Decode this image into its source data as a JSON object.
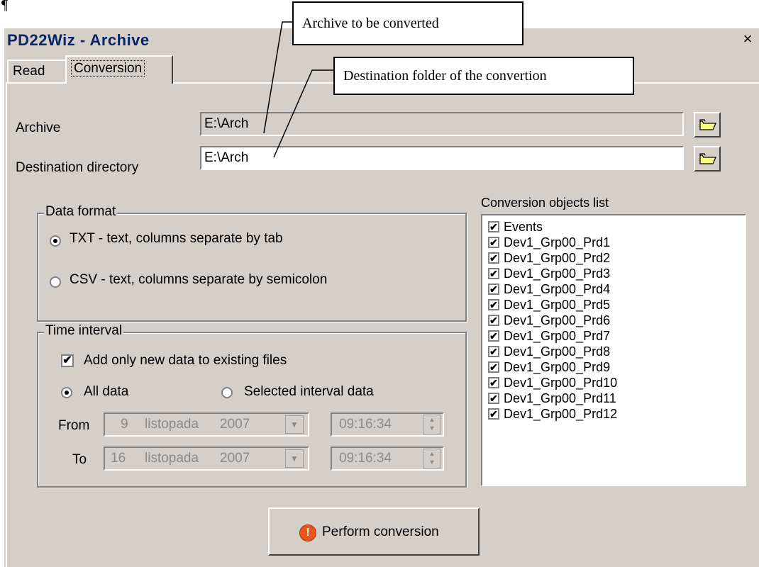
{
  "marker": "¶",
  "window": {
    "title": "PD22Wiz - Archive",
    "close_glyph": "×"
  },
  "tabs": [
    {
      "label": "Read"
    },
    {
      "label": "Conversion"
    }
  ],
  "archive": {
    "label": "Archive",
    "value": "E:\\Arch"
  },
  "destination": {
    "label": "Destination directory",
    "value": "E:\\Arch"
  },
  "data_format": {
    "legend": "Data format",
    "options": [
      {
        "label": "TXT - text, columns separate by tab",
        "selected": true
      },
      {
        "label": "CSV - text, columns separate by semicolon",
        "selected": false
      }
    ]
  },
  "time_interval": {
    "legend": "Time interval",
    "add_new_label": "Add only new data to existing files",
    "add_new_checked": true,
    "all_data_label": "All data",
    "selected_interval_label": "Selected interval data",
    "from_label": "From",
    "to_label": "To",
    "from": {
      "day": "9",
      "month": "listopada",
      "year": "2007",
      "time": "09:16:34"
    },
    "to": {
      "day": "16",
      "month": "listopada",
      "year": "2007",
      "time": "09:16:34"
    }
  },
  "objects": {
    "label": "Conversion objects list",
    "items": [
      "Events",
      "Dev1_Grp00_Prd1",
      "Dev1_Grp00_Prd2",
      "Dev1_Grp00_Prd3",
      "Dev1_Grp00_Prd4",
      "Dev1_Grp00_Prd5",
      "Dev1_Grp00_Prd6",
      "Dev1_Grp00_Prd7",
      "Dev1_Grp00_Prd8",
      "Dev1_Grp00_Prd9",
      "Dev1_Grp00_Prd10",
      "Dev1_Grp00_Prd11",
      "Dev1_Grp00_Prd12"
    ]
  },
  "perform_button": {
    "label": "Perform conversion"
  },
  "annotations": [
    {
      "text": "Archive to be converted"
    },
    {
      "text": "Destination folder of the convertion"
    }
  ]
}
